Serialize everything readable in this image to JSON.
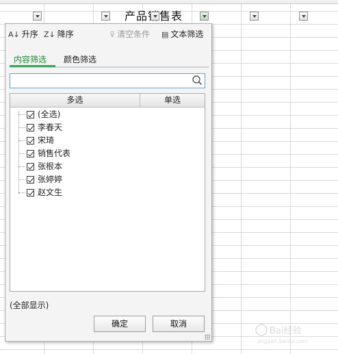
{
  "sheet": {
    "title": "产品销售表"
  },
  "toolbar": {
    "sort_asc": "升序",
    "sort_desc": "降序",
    "clear_filter": "清空条件",
    "text_filter": "文本筛选"
  },
  "tabs": [
    {
      "label": "内容筛选",
      "active": true
    },
    {
      "label": "颜色筛选",
      "active": false
    }
  ],
  "search": {
    "value": "",
    "placeholder": ""
  },
  "list": {
    "headers": [
      "多选",
      "单选"
    ],
    "items": [
      {
        "label": "(全选)",
        "checked": true
      },
      {
        "label": "李春天",
        "checked": true
      },
      {
        "label": "宋琦",
        "checked": true
      },
      {
        "label": "销售代表",
        "checked": true
      },
      {
        "label": "张根本",
        "checked": true
      },
      {
        "label": "张婷婷",
        "checked": true
      },
      {
        "label": "赵文生",
        "checked": true
      }
    ]
  },
  "show_all": "(全部显示)",
  "buttons": {
    "ok": "确定",
    "cancel": "取消"
  },
  "colors": {
    "accent_green": "#1e8a3a",
    "search_border": "#5aa4d6"
  },
  "watermark": {
    "text": "Bai经验",
    "subtext": "jingyan.baidu.com"
  }
}
